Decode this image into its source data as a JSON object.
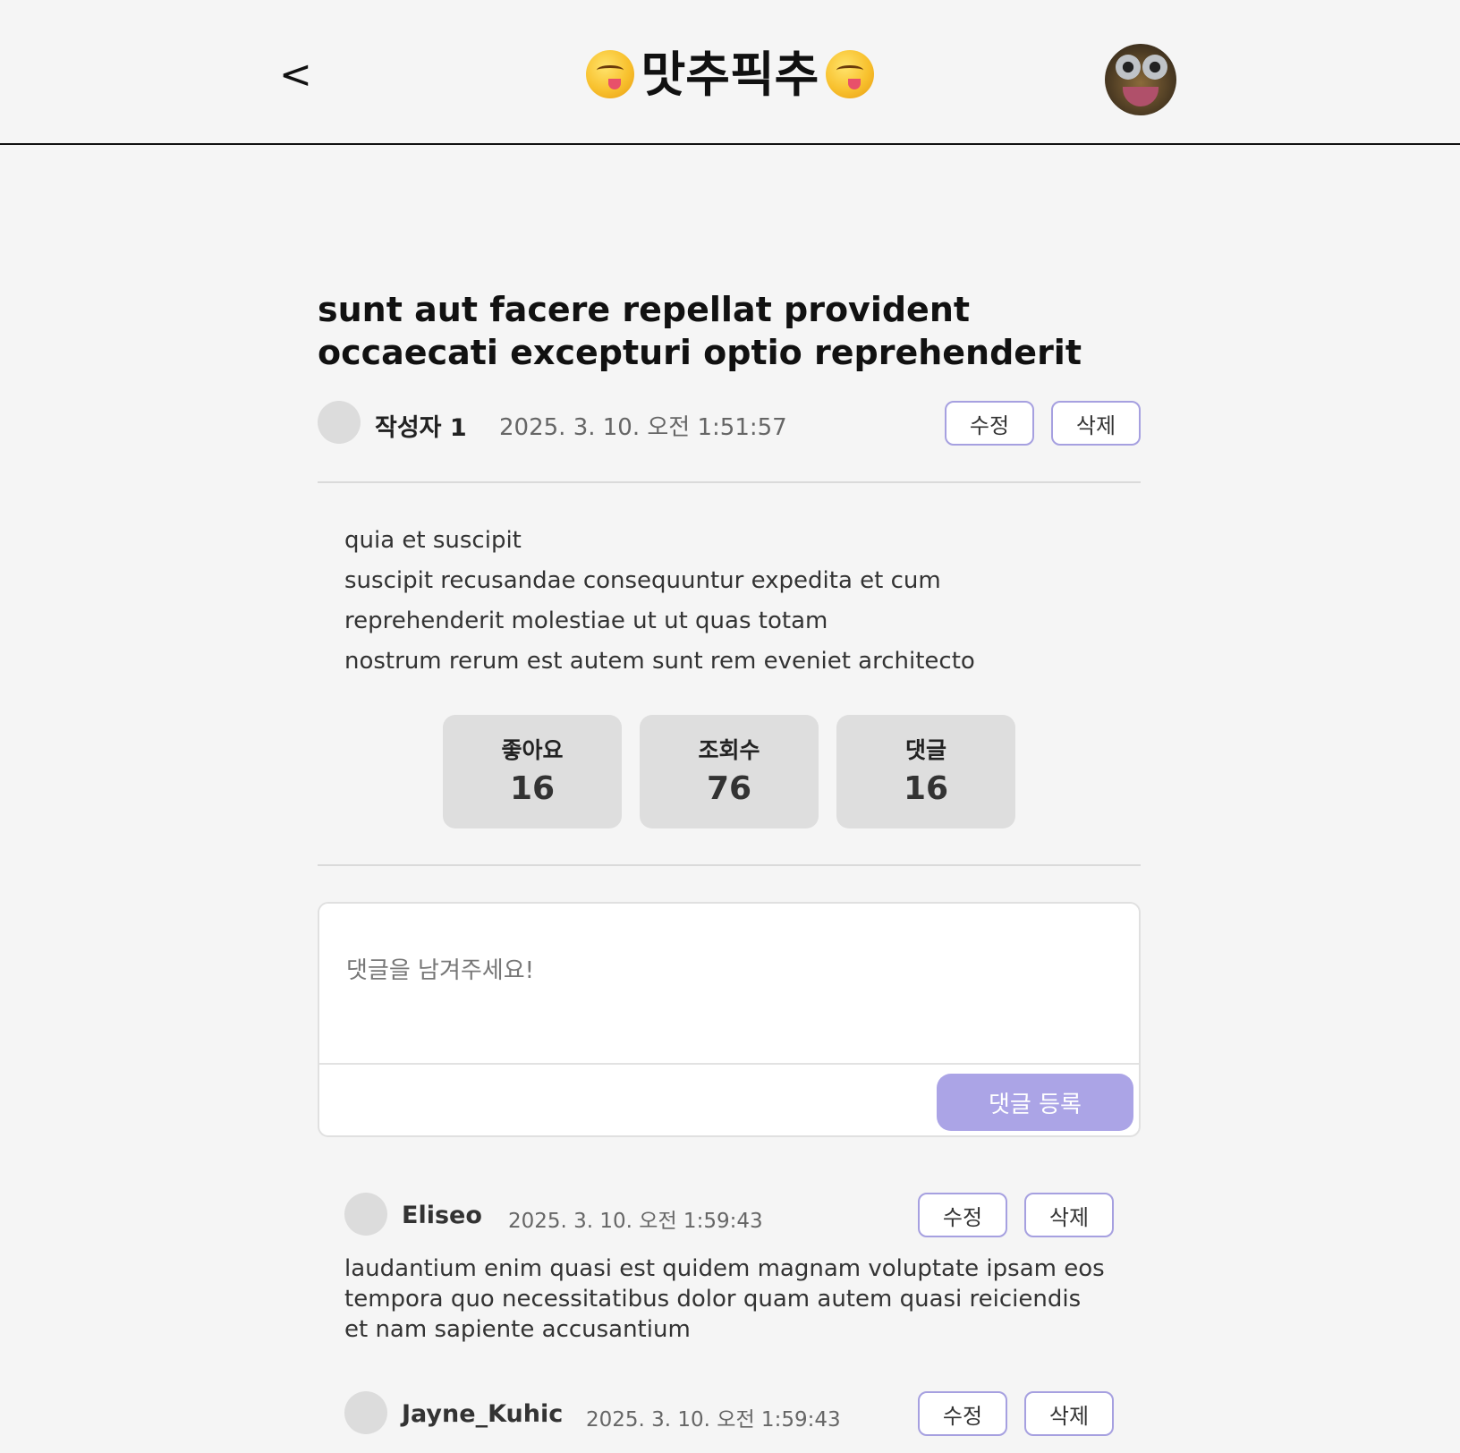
{
  "header": {
    "back_label": "<",
    "brand_title": "맛추픽추",
    "brand_emoji": "yum-face-emoji",
    "profile_avatar": "profile-avatar-image"
  },
  "post": {
    "title": "sunt aut facere repellat provident occaecati excepturi optio reprehenderit",
    "author": "작성자 1",
    "date": "2025. 3. 10. 오전 1:51:57",
    "edit_label": "수정",
    "delete_label": "삭제",
    "body_lines": [
      "quia et suscipit",
      "suscipit recusandae consequuntur expedita et cum",
      "reprehenderit molestiae ut ut quas totam",
      "nostrum rerum est autem sunt rem eveniet architecto"
    ]
  },
  "stats": [
    {
      "label": "좋아요",
      "value": "16"
    },
    {
      "label": "조회수",
      "value": "76"
    },
    {
      "label": "댓글",
      "value": "16"
    }
  ],
  "comment_form": {
    "placeholder": "댓글을 남겨주세요!",
    "submit_label": "댓글 등록"
  },
  "comments": [
    {
      "author": "Eliseo",
      "date": "2025. 3. 10. 오전 1:59:43",
      "edit_label": "수정",
      "delete_label": "삭제",
      "text": "laudantium enim quasi est quidem magnam voluptate ipsam eos tempora quo necessitatibus dolor quam autem quasi reiciendis et nam sapiente accusantium"
    },
    {
      "author": "Jayne_Kuhic",
      "date": "2025. 3. 10. 오전 1:59:43",
      "edit_label": "수정",
      "delete_label": "삭제",
      "text": ""
    }
  ],
  "colors": {
    "accent": "#aba4e6",
    "button_border": "#a6a0e0",
    "background": "#f5f5f5"
  }
}
